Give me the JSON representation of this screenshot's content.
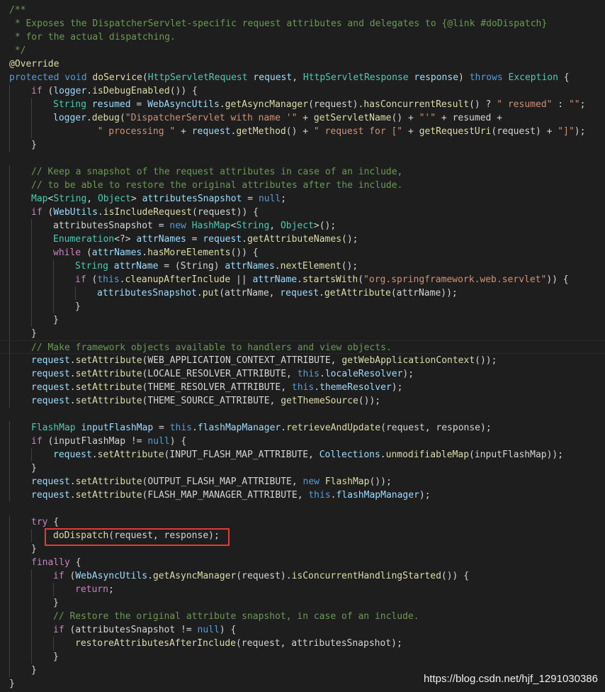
{
  "colors": {
    "background": "#1e1e1e",
    "comment": "#6a9955",
    "keyword": "#569cd6",
    "control": "#c586c0",
    "type": "#4ec9b0",
    "function": "#dcdcaa",
    "variable": "#9cdcfe",
    "string": "#ce9178",
    "plain": "#d4d4d4",
    "highlight_box": "#e53935"
  },
  "editor": {
    "lines": [
      {
        "indent": 0,
        "tokens": [
          [
            "c",
            "/**"
          ]
        ]
      },
      {
        "indent": 0,
        "tokens": [
          [
            "c",
            " * Exposes the DispatcherServlet-specific request attributes and delegates to {@link #doDispatch}"
          ]
        ]
      },
      {
        "indent": 0,
        "tokens": [
          [
            "c",
            " * for the actual dispatching."
          ]
        ]
      },
      {
        "indent": 0,
        "tokens": [
          [
            "c",
            " */"
          ]
        ]
      },
      {
        "indent": 0,
        "tokens": [
          [
            "a",
            "@Override"
          ]
        ]
      },
      {
        "indent": 0,
        "tokens": [
          [
            "k",
            "protected"
          ],
          [
            "p",
            " "
          ],
          [
            "k",
            "void"
          ],
          [
            "p",
            " "
          ],
          [
            "f",
            "doService"
          ],
          [
            "p",
            "("
          ],
          [
            "t",
            "HttpServletRequest"
          ],
          [
            "p",
            " "
          ],
          [
            "v",
            "request"
          ],
          [
            "p",
            ", "
          ],
          [
            "t",
            "HttpServletResponse"
          ],
          [
            "p",
            " "
          ],
          [
            "v",
            "response"
          ],
          [
            "p",
            ") "
          ],
          [
            "k",
            "throws"
          ],
          [
            "p",
            " "
          ],
          [
            "t",
            "Exception"
          ],
          [
            "p",
            " {"
          ]
        ]
      },
      {
        "indent": 1,
        "tokens": [
          [
            "x",
            "if"
          ],
          [
            "p",
            " ("
          ],
          [
            "v",
            "logger"
          ],
          [
            "p",
            "."
          ],
          [
            "f",
            "isDebugEnabled"
          ],
          [
            "p",
            "()) {"
          ]
        ]
      },
      {
        "indent": 2,
        "tokens": [
          [
            "t",
            "String"
          ],
          [
            "p",
            " "
          ],
          [
            "v",
            "resumed"
          ],
          [
            "p",
            " = "
          ],
          [
            "v",
            "WebAsyncUtils"
          ],
          [
            "p",
            "."
          ],
          [
            "f",
            "getAsyncManager"
          ],
          [
            "p",
            "(request)."
          ],
          [
            "f",
            "hasConcurrentResult"
          ],
          [
            "p",
            "() ? "
          ],
          [
            "s",
            "\" resumed\""
          ],
          [
            "p",
            " : "
          ],
          [
            "s",
            "\"\""
          ],
          [
            "p",
            ";"
          ]
        ]
      },
      {
        "indent": 2,
        "tokens": [
          [
            "v",
            "logger"
          ],
          [
            "p",
            "."
          ],
          [
            "f",
            "debug"
          ],
          [
            "p",
            "("
          ],
          [
            "s",
            "\"DispatcherServlet with name '\""
          ],
          [
            "p",
            " + "
          ],
          [
            "f",
            "getServletName"
          ],
          [
            "p",
            "() + "
          ],
          [
            "s",
            "\"'\""
          ],
          [
            "p",
            " + resumed +"
          ]
        ]
      },
      {
        "indent": 2,
        "tokens": [
          [
            "p",
            "        "
          ],
          [
            "s",
            "\" processing \""
          ],
          [
            "p",
            " + "
          ],
          [
            "v",
            "request"
          ],
          [
            "p",
            "."
          ],
          [
            "f",
            "getMethod"
          ],
          [
            "p",
            "() + "
          ],
          [
            "s",
            "\" request for [\""
          ],
          [
            "p",
            " + "
          ],
          [
            "f",
            "getRequestUri"
          ],
          [
            "p",
            "(request) + "
          ],
          [
            "s",
            "\"]\""
          ],
          [
            "p",
            ");"
          ]
        ]
      },
      {
        "indent": 1,
        "tokens": [
          [
            "p",
            "}"
          ]
        ]
      },
      {
        "indent": 0,
        "tokens": [
          [
            "p",
            ""
          ]
        ]
      },
      {
        "indent": 1,
        "tokens": [
          [
            "c",
            "// Keep a snapshot of the request attributes in case of an include,"
          ]
        ]
      },
      {
        "indent": 1,
        "tokens": [
          [
            "c",
            "// to be able to restore the original attributes after the include."
          ]
        ]
      },
      {
        "indent": 1,
        "tokens": [
          [
            "t",
            "Map"
          ],
          [
            "p",
            "<"
          ],
          [
            "t",
            "String"
          ],
          [
            "p",
            ", "
          ],
          [
            "t",
            "Object"
          ],
          [
            "p",
            "> "
          ],
          [
            "v",
            "attributesSnapshot"
          ],
          [
            "p",
            " = "
          ],
          [
            "k",
            "null"
          ],
          [
            "p",
            ";"
          ]
        ]
      },
      {
        "indent": 1,
        "tokens": [
          [
            "x",
            "if"
          ],
          [
            "p",
            " ("
          ],
          [
            "v",
            "WebUtils"
          ],
          [
            "p",
            "."
          ],
          [
            "f",
            "isIncludeRequest"
          ],
          [
            "p",
            "(request)) {"
          ]
        ]
      },
      {
        "indent": 2,
        "tokens": [
          [
            "p",
            "attributesSnapshot = "
          ],
          [
            "k",
            "new"
          ],
          [
            "p",
            " "
          ],
          [
            "t",
            "HashMap"
          ],
          [
            "p",
            "<"
          ],
          [
            "t",
            "String"
          ],
          [
            "p",
            ", "
          ],
          [
            "t",
            "Object"
          ],
          [
            "p",
            ">();"
          ]
        ]
      },
      {
        "indent": 2,
        "tokens": [
          [
            "t",
            "Enumeration"
          ],
          [
            "p",
            "<?> "
          ],
          [
            "v",
            "attrNames"
          ],
          [
            "p",
            " = "
          ],
          [
            "v",
            "request"
          ],
          [
            "p",
            "."
          ],
          [
            "f",
            "getAttributeNames"
          ],
          [
            "p",
            "();"
          ]
        ]
      },
      {
        "indent": 2,
        "tokens": [
          [
            "x",
            "while"
          ],
          [
            "p",
            " ("
          ],
          [
            "v",
            "attrNames"
          ],
          [
            "p",
            "."
          ],
          [
            "f",
            "hasMoreElements"
          ],
          [
            "p",
            "()) {"
          ]
        ]
      },
      {
        "indent": 3,
        "tokens": [
          [
            "t",
            "String"
          ],
          [
            "p",
            " "
          ],
          [
            "v",
            "attrName"
          ],
          [
            "p",
            " = (String) "
          ],
          [
            "v",
            "attrNames"
          ],
          [
            "p",
            "."
          ],
          [
            "f",
            "nextElement"
          ],
          [
            "p",
            "();"
          ]
        ]
      },
      {
        "indent": 3,
        "tokens": [
          [
            "x",
            "if"
          ],
          [
            "p",
            " ("
          ],
          [
            "k",
            "this"
          ],
          [
            "p",
            "."
          ],
          [
            "f",
            "cleanupAfterInclude"
          ],
          [
            "p",
            " || "
          ],
          [
            "v",
            "attrName"
          ],
          [
            "p",
            "."
          ],
          [
            "f",
            "startsWith"
          ],
          [
            "p",
            "("
          ],
          [
            "s",
            "\"org.springframework.web.servlet\""
          ],
          [
            "p",
            ")) {"
          ]
        ]
      },
      {
        "indent": 4,
        "tokens": [
          [
            "v",
            "attributesSnapshot"
          ],
          [
            "p",
            "."
          ],
          [
            "f",
            "put"
          ],
          [
            "p",
            "(attrName, "
          ],
          [
            "v",
            "request"
          ],
          [
            "p",
            "."
          ],
          [
            "f",
            "getAttribute"
          ],
          [
            "p",
            "(attrName));"
          ]
        ]
      },
      {
        "indent": 3,
        "tokens": [
          [
            "p",
            "}"
          ]
        ]
      },
      {
        "indent": 2,
        "tokens": [
          [
            "p",
            "}"
          ]
        ]
      },
      {
        "indent": 1,
        "tokens": [
          [
            "p",
            "}"
          ]
        ]
      },
      {
        "indent": 1,
        "cursor": true,
        "tokens": [
          [
            "c",
            "// Make framework objects available to handlers and view objects."
          ]
        ]
      },
      {
        "indent": 1,
        "tokens": [
          [
            "v",
            "request"
          ],
          [
            "p",
            "."
          ],
          [
            "f",
            "setAttribute"
          ],
          [
            "p",
            "(WEB_APPLICATION_CONTEXT_ATTRIBUTE, "
          ],
          [
            "f",
            "getWebApplicationContext"
          ],
          [
            "p",
            "());"
          ]
        ]
      },
      {
        "indent": 1,
        "tokens": [
          [
            "v",
            "request"
          ],
          [
            "p",
            "."
          ],
          [
            "f",
            "setAttribute"
          ],
          [
            "p",
            "(LOCALE_RESOLVER_ATTRIBUTE, "
          ],
          [
            "k",
            "this"
          ],
          [
            "p",
            "."
          ],
          [
            "v",
            "localeResolver"
          ],
          [
            "p",
            ");"
          ]
        ]
      },
      {
        "indent": 1,
        "tokens": [
          [
            "v",
            "request"
          ],
          [
            "p",
            "."
          ],
          [
            "f",
            "setAttribute"
          ],
          [
            "p",
            "(THEME_RESOLVER_ATTRIBUTE, "
          ],
          [
            "k",
            "this"
          ],
          [
            "p",
            "."
          ],
          [
            "v",
            "themeResolver"
          ],
          [
            "p",
            ");"
          ]
        ]
      },
      {
        "indent": 1,
        "tokens": [
          [
            "v",
            "request"
          ],
          [
            "p",
            "."
          ],
          [
            "f",
            "setAttribute"
          ],
          [
            "p",
            "(THEME_SOURCE_ATTRIBUTE, "
          ],
          [
            "f",
            "getThemeSource"
          ],
          [
            "p",
            "());"
          ]
        ]
      },
      {
        "indent": 0,
        "tokens": [
          [
            "p",
            ""
          ]
        ]
      },
      {
        "indent": 1,
        "tokens": [
          [
            "t",
            "FlashMap"
          ],
          [
            "p",
            " "
          ],
          [
            "v",
            "inputFlashMap"
          ],
          [
            "p",
            " = "
          ],
          [
            "k",
            "this"
          ],
          [
            "p",
            "."
          ],
          [
            "v",
            "flashMapManager"
          ],
          [
            "p",
            "."
          ],
          [
            "f",
            "retrieveAndUpdate"
          ],
          [
            "p",
            "(request, response);"
          ]
        ]
      },
      {
        "indent": 1,
        "tokens": [
          [
            "x",
            "if"
          ],
          [
            "p",
            " (inputFlashMap != "
          ],
          [
            "k",
            "null"
          ],
          [
            "p",
            ") {"
          ]
        ]
      },
      {
        "indent": 2,
        "tokens": [
          [
            "v",
            "request"
          ],
          [
            "p",
            "."
          ],
          [
            "f",
            "setAttribute"
          ],
          [
            "p",
            "(INPUT_FLASH_MAP_ATTRIBUTE, "
          ],
          [
            "v",
            "Collections"
          ],
          [
            "p",
            "."
          ],
          [
            "f",
            "unmodifiableMap"
          ],
          [
            "p",
            "(inputFlashMap));"
          ]
        ]
      },
      {
        "indent": 1,
        "tokens": [
          [
            "p",
            "}"
          ]
        ]
      },
      {
        "indent": 1,
        "tokens": [
          [
            "v",
            "request"
          ],
          [
            "p",
            "."
          ],
          [
            "f",
            "setAttribute"
          ],
          [
            "p",
            "(OUTPUT_FLASH_MAP_ATTRIBUTE, "
          ],
          [
            "k",
            "new"
          ],
          [
            "p",
            " "
          ],
          [
            "f",
            "FlashMap"
          ],
          [
            "p",
            "());"
          ]
        ]
      },
      {
        "indent": 1,
        "tokens": [
          [
            "v",
            "request"
          ],
          [
            "p",
            "."
          ],
          [
            "f",
            "setAttribute"
          ],
          [
            "p",
            "(FLASH_MAP_MANAGER_ATTRIBUTE, "
          ],
          [
            "k",
            "this"
          ],
          [
            "p",
            "."
          ],
          [
            "v",
            "flashMapManager"
          ],
          [
            "p",
            ");"
          ]
        ]
      },
      {
        "indent": 0,
        "tokens": [
          [
            "p",
            ""
          ]
        ]
      },
      {
        "indent": 1,
        "tokens": [
          [
            "x",
            "try"
          ],
          [
            "p",
            " {"
          ]
        ]
      },
      {
        "indent": 2,
        "tokens": [
          [
            "f",
            "doDispatch"
          ],
          [
            "p",
            "(request, response);"
          ]
        ]
      },
      {
        "indent": 1,
        "tokens": [
          [
            "p",
            "}"
          ]
        ]
      },
      {
        "indent": 1,
        "tokens": [
          [
            "x",
            "finally"
          ],
          [
            "p",
            " {"
          ]
        ]
      },
      {
        "indent": 2,
        "tokens": [
          [
            "x",
            "if"
          ],
          [
            "p",
            " ("
          ],
          [
            "v",
            "WebAsyncUtils"
          ],
          [
            "p",
            "."
          ],
          [
            "f",
            "getAsyncManager"
          ],
          [
            "p",
            "(request)."
          ],
          [
            "f",
            "isConcurrentHandlingStarted"
          ],
          [
            "p",
            "()) {"
          ]
        ]
      },
      {
        "indent": 3,
        "tokens": [
          [
            "x",
            "return"
          ],
          [
            "p",
            ";"
          ]
        ]
      },
      {
        "indent": 2,
        "tokens": [
          [
            "p",
            "}"
          ]
        ]
      },
      {
        "indent": 2,
        "tokens": [
          [
            "c",
            "// Restore the original attribute snapshot, in case of an include."
          ]
        ]
      },
      {
        "indent": 2,
        "tokens": [
          [
            "x",
            "if"
          ],
          [
            "p",
            " (attributesSnapshot != "
          ],
          [
            "k",
            "null"
          ],
          [
            "p",
            ") {"
          ]
        ]
      },
      {
        "indent": 3,
        "tokens": [
          [
            "f",
            "restoreAttributesAfterInclude"
          ],
          [
            "p",
            "(request, attributesSnapshot);"
          ]
        ]
      },
      {
        "indent": 2,
        "tokens": [
          [
            "p",
            "}"
          ]
        ]
      },
      {
        "indent": 1,
        "tokens": [
          [
            "p",
            "}"
          ]
        ]
      },
      {
        "indent": 0,
        "tokens": [
          [
            "p",
            "}"
          ]
        ]
      }
    ]
  },
  "watermark": {
    "text": "https://blog.csdn.net/hjf_1291030386"
  }
}
